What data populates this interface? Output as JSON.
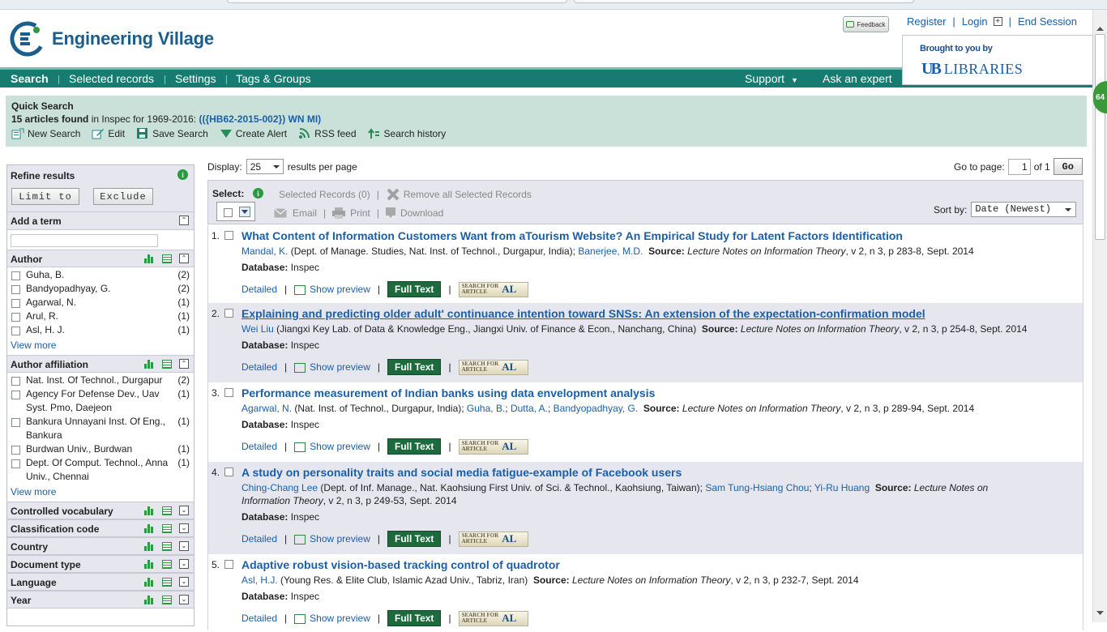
{
  "header": {
    "app_title": "Engineering Village",
    "feedback_label": "Feedback",
    "top_links": [
      "Register",
      "Login",
      "End Session"
    ],
    "brought_by": "Brought to you by",
    "library_mark": "UB",
    "library_name": "LIBRARIES"
  },
  "nav": {
    "items": [
      "Search",
      "Selected records",
      "Settings",
      "Tags & Groups"
    ],
    "support": "Support",
    "ask": "Ask an expert"
  },
  "quick_search": {
    "title": "Quick Search",
    "count_text": "15 articles found",
    "scope_text": " in Inspec for 1969-2016: ",
    "query": "(({HB62-2015-002}) WN MI)",
    "actions": [
      "New Search",
      "Edit",
      "Save Search",
      "Create Alert",
      "RSS feed",
      "Search history"
    ]
  },
  "refine": {
    "title": "Refine results",
    "limit_label": "Limit to",
    "exclude_label": "Exclude",
    "add_term": "Add a term",
    "view_more": "View more",
    "author": {
      "title": "Author",
      "items": [
        {
          "label": "Guha, B.",
          "count": "(2)"
        },
        {
          "label": "Bandyopadhyay, G.",
          "count": "(2)"
        },
        {
          "label": "Agarwal, N.",
          "count": "(1)"
        },
        {
          "label": "Arul, R.",
          "count": "(1)"
        },
        {
          "label": "Asl, H. J.",
          "count": "(1)"
        }
      ]
    },
    "affiliation": {
      "title": "Author affiliation",
      "items": [
        {
          "label": "Nat. Inst. Of Technol., Durgapur",
          "count": "(2)"
        },
        {
          "label": "Agency For Defense Dev., Uav Syst. Pmo, Daejeon",
          "count": "(1)"
        },
        {
          "label": "Bankura Unnayani Inst. Of Eng., Bankura",
          "count": "(1)"
        },
        {
          "label": "Burdwan Univ., Burdwan",
          "count": "(1)"
        },
        {
          "label": "Dept. Of Comput. Technol., Anna Univ., Chennai",
          "count": "(1)"
        }
      ]
    },
    "collapsed": [
      "Controlled vocabulary",
      "Classification code",
      "Country",
      "Document type",
      "Language",
      "Year"
    ]
  },
  "toolbar": {
    "display_label": "Display:",
    "per_page": "25",
    "per_page_suffix": "results per page",
    "goto_label": "Go to page:",
    "page": "1",
    "of_label": "of 1",
    "go": "Go",
    "select_label": "Select:",
    "selected_records": "Selected Records (0)",
    "remove_all": "Remove all Selected Records",
    "email": "Email",
    "print": "Print",
    "download": "Download",
    "sort_label": "Sort by:",
    "sort_value": "Date (Newest)"
  },
  "result_links": {
    "detailed": "Detailed",
    "preview": "Show preview",
    "fulltext": "Full Text",
    "sfa_top": "SEARCH FOR",
    "sfa_bottom": "ARTICLE",
    "sfa_mark": "AL",
    "db_label": "Database:",
    "db_value": "Inspec",
    "source_label": "Source:"
  },
  "results": [
    {
      "num": "1.",
      "title": "What Content of Information Customers Want from aTourism Website? An Empirical Study for Latent Factors Identification",
      "a1": "Mandal, K.",
      "aff1": " (Dept. of Manage. Studies, Nat. Inst. of Technol., Durgapur, India); ",
      "a2": "Banerjee, M.D.",
      "aff2": "",
      "a3": "",
      "aff3": "",
      "a4": "",
      "aff4": "",
      "source_title": "Lecture Notes on Information Theory",
      "source_rest": ", v 2, n 3, p 283-8, Sept. 2014"
    },
    {
      "num": "2.",
      "title": "Explaining and predicting older adult' continuance intention toward SNSs: An extension of the expectation-confirmation model",
      "a1": "Wei Liu",
      "aff1": " (Jiangxi Key Lab. of Data & Knowledge Eng., Jiangxi Univ. of Finance & Econ., Nanchang, China) ",
      "a2": "",
      "aff2": "",
      "a3": "",
      "aff3": "",
      "a4": "",
      "aff4": "",
      "source_title": "Lecture Notes on Information Theory",
      "source_rest": ", v 2, n 3, p 254-8, Sept. 2014"
    },
    {
      "num": "3.",
      "title": "Performance measurement of Indian banks using data envelopment analysis",
      "a1": "Agarwal, N.",
      "aff1": " (Nat. Inst. of Technol., Durgapur, India); ",
      "a2": "Guha, B.",
      "aff2": "; ",
      "a3": "Dutta, A.",
      "aff3": "; ",
      "a4": "Bandyopadhyay, G.",
      "aff4": " ",
      "source_title": "Lecture Notes on Information Theory",
      "source_rest": ", v 2, n 3, p 289-94, Sept. 2014"
    },
    {
      "num": "4.",
      "title": "A study on personality traits and social media fatigue-example of Facebook users",
      "a1": "Ching-Chang Lee",
      "aff1": " (Dept. of Inf. Manage., Nat. Kaohsiung First Univ. of Sci. & Technol., Kaohsiung, Taiwan); ",
      "a2": "Sam Tung-Hsiang Chou",
      "aff2": "; ",
      "a3": "Yi-Ru Huang",
      "aff3": " ",
      "a4": "",
      "aff4": "",
      "source_title": "Lecture Notes on Information Theory",
      "source_rest": ", v 2, n 3, p 249-53, Sept. 2014"
    },
    {
      "num": "5.",
      "title": "Adaptive robust vision-based tracking control of quadrotor",
      "a1": "Asl, H.J.",
      "aff1": " (Young Res. & Elite Club, Islamic Azad Univ., Tabriz, Iran) ",
      "a2": "",
      "aff2": "",
      "a3": "",
      "aff3": "",
      "a4": "",
      "aff4": "",
      "source_title": "Lecture Notes on Information Theory",
      "source_rest": ", v 2, n 3, p 232-7, Sept. 2014"
    }
  ],
  "side_badge": "64"
}
